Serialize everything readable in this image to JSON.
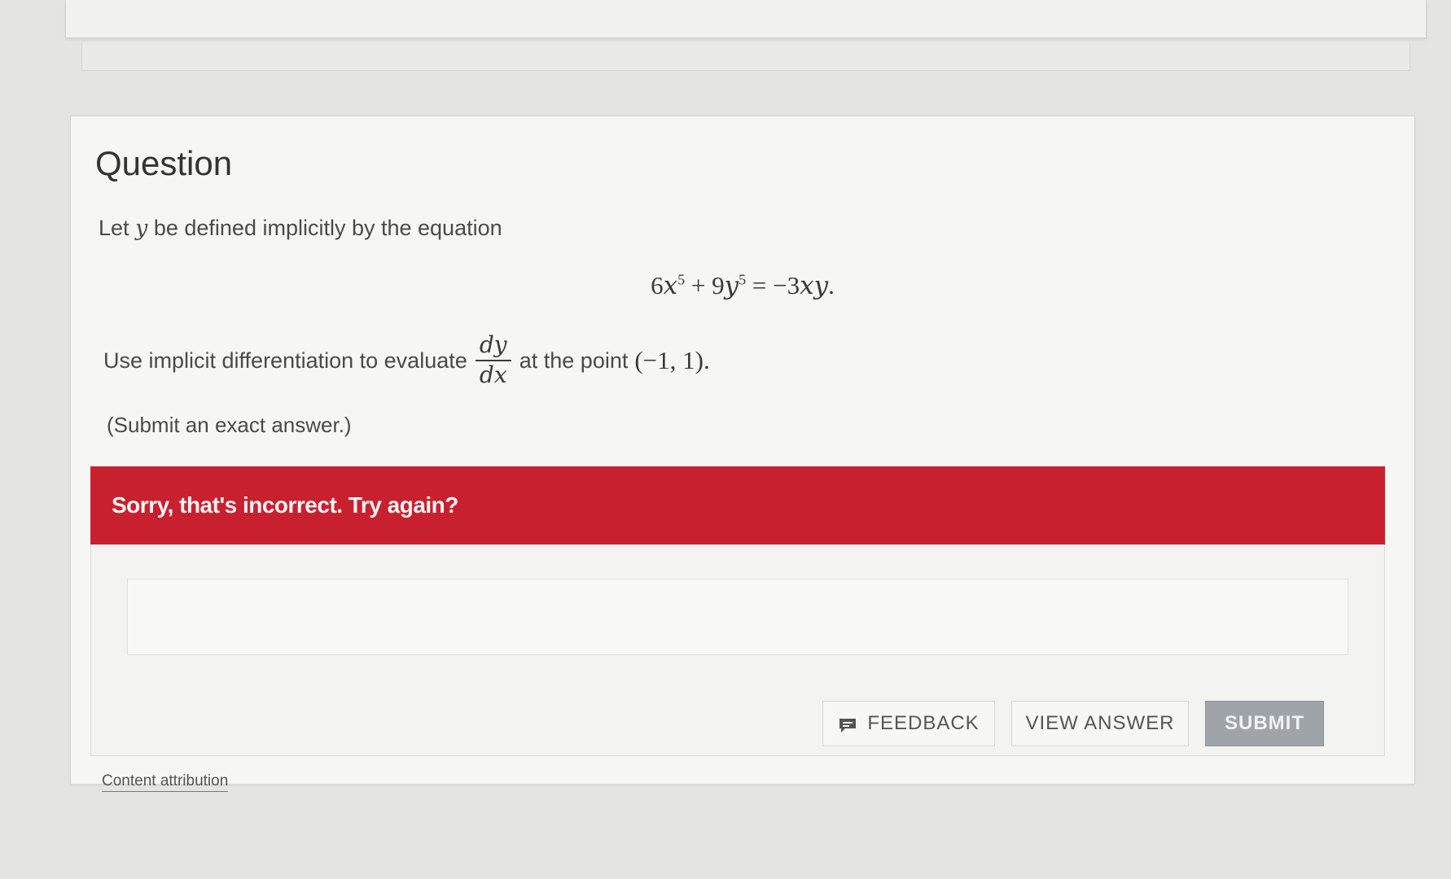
{
  "question": {
    "heading": "Question",
    "intro_before": "Let",
    "intro_var": "y",
    "intro_after": "be defined implicitly by the equation",
    "equation": {
      "term1_coef": "6",
      "term1_var": "x",
      "term1_exp": "5",
      "op1": "+",
      "term2_coef": "9",
      "term2_var": "y",
      "term2_exp": "5",
      "equals": "=",
      "rhs_coef": "−3",
      "rhs_vars": "xy",
      "end": "."
    },
    "instruction_before": "Use implicit differentiation to evaluate",
    "derivative_numerator": "dy",
    "derivative_denominator": "dx",
    "instruction_after": "at the point",
    "point": "(−1, 1).",
    "hint": "(Submit an exact answer.)"
  },
  "feedback": {
    "error_message": "Sorry, that's incorrect. Try again?",
    "error_color": "#c8202f"
  },
  "answer": {
    "value": "",
    "placeholder": ""
  },
  "buttons": {
    "feedback_label": "FEEDBACK",
    "feedback_icon": "comment-icon",
    "view_answer_label": "VIEW ANSWER",
    "submit_label": "SUBMIT",
    "submit_color": "#9fa4a9"
  },
  "footer": {
    "attribution_label": "Content attribution"
  }
}
